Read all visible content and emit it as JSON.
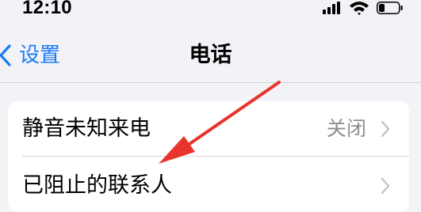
{
  "status_bar": {
    "time": "12:10",
    "icons": [
      "cellular-signal-icon",
      "wifi-icon",
      "battery-icon"
    ]
  },
  "nav": {
    "back_label": "设置",
    "title": "电话"
  },
  "settings": {
    "rows": [
      {
        "label": "静音未知来电",
        "value": "关闭"
      },
      {
        "label": "已阻止的联系人",
        "value": ""
      }
    ]
  },
  "colors": {
    "accent": "#1a7cf5",
    "background": "#f2f2f7",
    "annotation_arrow": "#e8342c"
  }
}
